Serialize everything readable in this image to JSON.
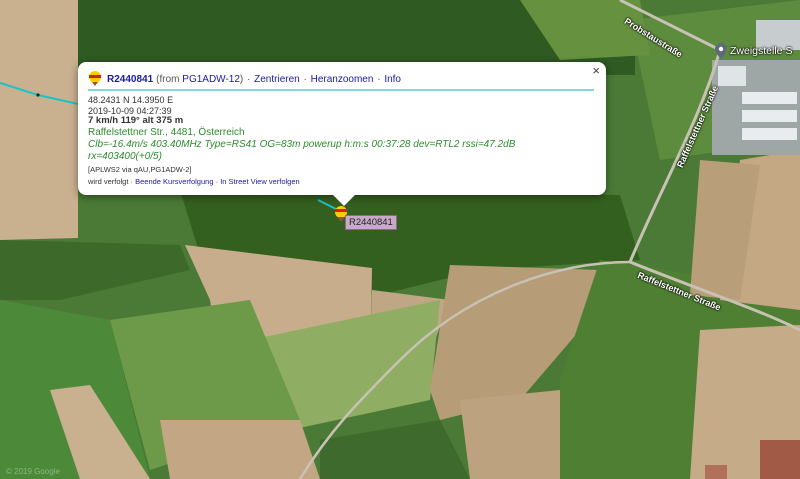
{
  "popup": {
    "callsign": "R2440841",
    "from_prefix": "(from",
    "from_station": "PG1ADW-12",
    "from_suffix": ")",
    "actions": [
      "Zentrieren",
      "Heranzoomen",
      "Info"
    ],
    "coordinates": "48.2431 N 14.3950 E",
    "timestamp": "2019-10-09 04:27:39",
    "speed_alt": "7 km/h 119° alt 375 m",
    "address": "Raffelstettner Str., 4481, Österreich",
    "comment_line1": "Clb=-16.4m/s 403.40MHz Type=RS41 OG=83m powerup h:m:s 00:37:28 dev=RTL2 rssi=47.2dB",
    "comment_line2": "rx=403400(+0/5)",
    "path": "[APLWS2 via qAU,PG1ADW-2]",
    "tracked_text": "wird verfolgt ·",
    "tracked_links": [
      "Beende Kursverfolgung",
      "In Street View verfolgen"
    ],
    "close_symbol": "×"
  },
  "marker": {
    "label": "R2440841",
    "icon": "balloon-icon"
  },
  "roads": {
    "probstau": "Probstaustraße",
    "raffel_vertical": "Raffelstettner Straße",
    "raffel_horizontal": "Raffelstettner Straße"
  },
  "poi": {
    "label": "Zweigstelle S",
    "icon": "location-pin-icon"
  },
  "watermark": "© 2019 Google",
  "colors": {
    "track": "#19c3c8",
    "link": "#1a1aa6",
    "comment": "#2e8b2e",
    "marker_label_bg": "#c9a9c9"
  }
}
